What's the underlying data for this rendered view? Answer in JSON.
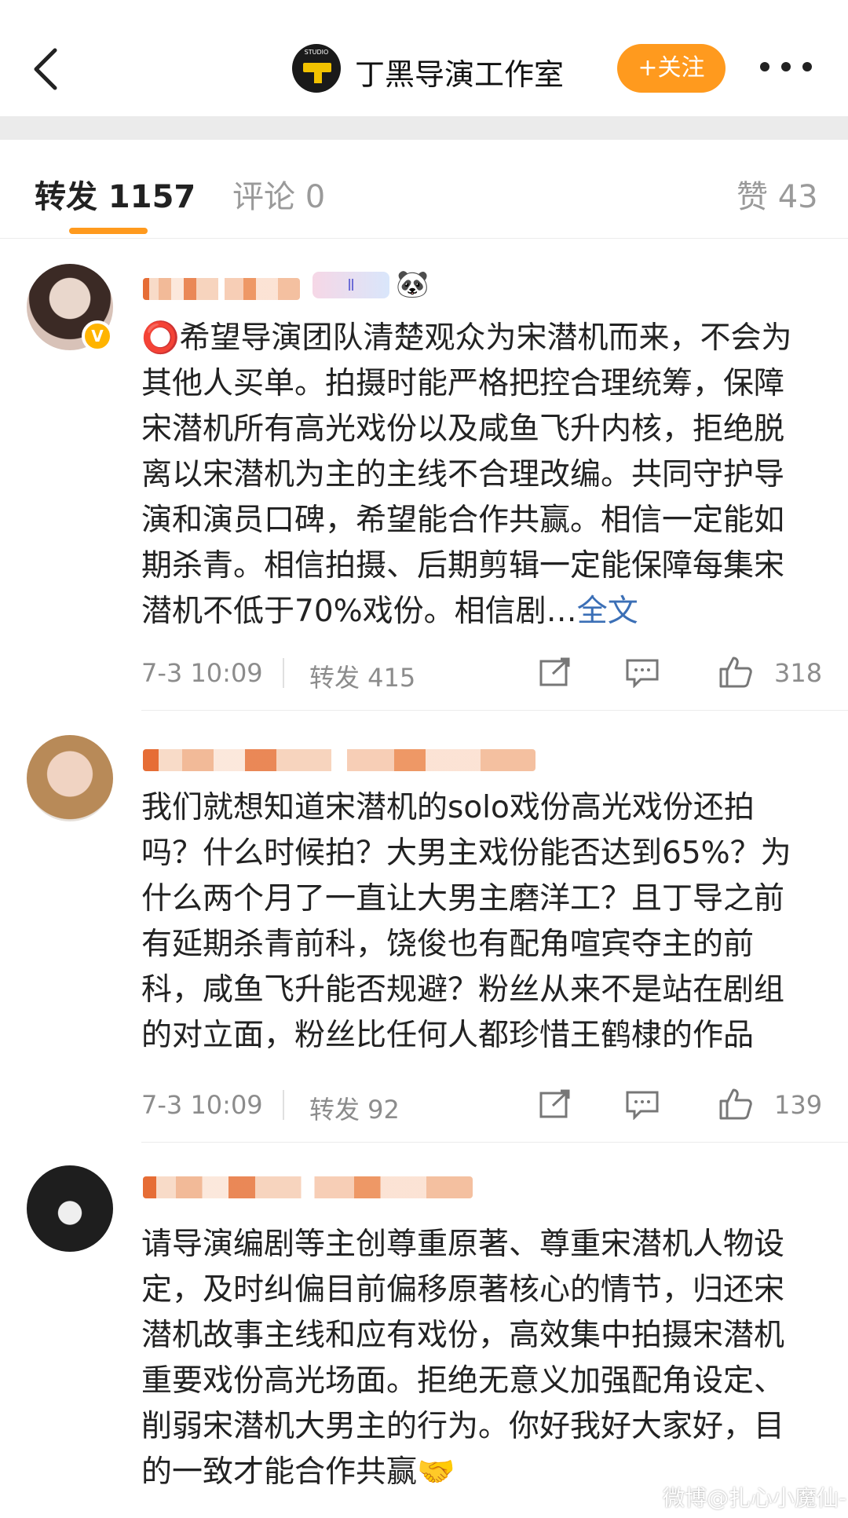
{
  "header": {
    "studio_name": "丁黑导演工作室",
    "follow_label": "+关注"
  },
  "tabs": {
    "repost": "转发 1157",
    "comment": "评论 0",
    "like": "赞 43"
  },
  "posts": [
    {
      "text": "⭕希望导演团队清楚观众为宋潜机而来，不会为其他人买单。拍摄时能严格把控合理统筹，保障宋潜机所有高光戏份以及咸鱼飞升内核，拒绝脱离以宋潜机为主的主线不合理改编。共同守护导演和演员口碑，希望能合作共赢。相信一定能如期杀青。相信拍摄、后期剪辑一定能保障每集宋潜机不低于70%戏份。相信剧…",
      "full_label": "全文",
      "badge_level": "Ⅱ",
      "emoji": "🐼",
      "time": "7-3 10:09",
      "repost": "转发 415",
      "likes": "318"
    },
    {
      "text": "我们就想知道宋潜机的solo戏份高光戏份还拍吗？什么时候拍？大男主戏份能否达到65%？为什么两个月了一直让大男主磨洋工？且丁导之前有延期杀青前科，饶俊也有配角喧宾夺主的前科，咸鱼飞升能否规避？粉丝从来不是站在剧组的对立面，粉丝比任何人都珍惜王鹤棣的作品",
      "time": "7-3 10:09",
      "repost": "转发 92",
      "likes": "139"
    },
    {
      "text": "请导演编剧等主创尊重原著、尊重宋潜机人物设定，及时纠偏目前偏移原著核心的情节，归还宋潜机故事主线和应有戏份，高效集中拍摄宋潜机重要戏份高光场面。拒绝无意义加强配角设定、削弱宋潜机大男主的行为。你好我好大家好，目的一致才能合作共赢🤝"
    }
  ],
  "watermark": "微博@扎心小魔仙-",
  "colors": {
    "accent": "#ff9a1e",
    "link": "#3b6fb6",
    "verified": "#ffb400"
  }
}
